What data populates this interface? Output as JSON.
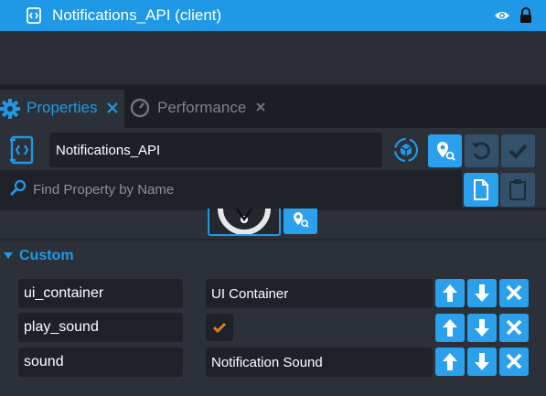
{
  "hierarchy": {
    "title": "Notifications_API (client)",
    "icon": "script-icon",
    "visibility_icon": "eye-icon",
    "lock_icon": "lock-icon"
  },
  "tabs": [
    {
      "label": "Properties",
      "icon": "gear-icon",
      "active": true
    },
    {
      "label": "Performance",
      "icon": "speedometer-icon",
      "active": false
    }
  ],
  "properties": {
    "name_value": "Notifications_API",
    "search_placeholder": "Find Property by Name"
  },
  "custom": {
    "section_label": "Custom",
    "rows": [
      {
        "name": "ui_container",
        "type": "reference",
        "value": "UI Container"
      },
      {
        "name": "play_sound",
        "type": "bool",
        "value": true
      },
      {
        "name": "sound",
        "type": "reference",
        "value": "Notification Sound"
      }
    ]
  },
  "colors": {
    "accent": "#1f99e6",
    "button_blue": "#2ba0ec",
    "checkmark": "#e07b1e"
  }
}
